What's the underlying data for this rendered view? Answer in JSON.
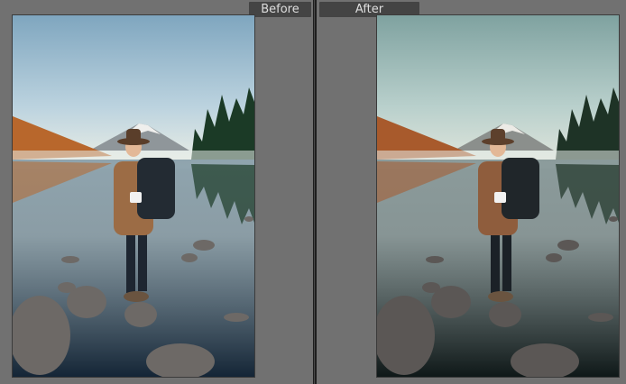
{
  "view_labels": {
    "before": "Before",
    "after": "After"
  },
  "colors": {
    "before": {
      "sky_top": "#7fa6bf",
      "sky_mid": "#bcd3df",
      "sky_bottom": "#eef0e6",
      "water_top": "#8fa4ae",
      "water_bottom": "#142536",
      "forest": "#1b3a26",
      "hill": "#b8672c",
      "mountain": "#8f969a",
      "snow": "#efefed",
      "rock": "#6d6966",
      "jacket": "#9c6c45",
      "pack": "#232b33",
      "hat": "#5a3e2a",
      "jeans": "#1e2631"
    },
    "after": {
      "sky_top": "#7fa2a0",
      "sky_mid": "#b9d0cc",
      "sky_bottom": "#e3e7dd",
      "water_top": "#8b9b9b",
      "water_bottom": "#0f1818",
      "forest": "#1e3326",
      "hill": "#a85a2c",
      "mountain": "#8b8f8c",
      "snow": "#ecebe6",
      "rock": "#5b5755",
      "jacket": "#8f5d3d",
      "pack": "#20262a",
      "hat": "#5d402c",
      "jeans": "#1b2127"
    }
  }
}
